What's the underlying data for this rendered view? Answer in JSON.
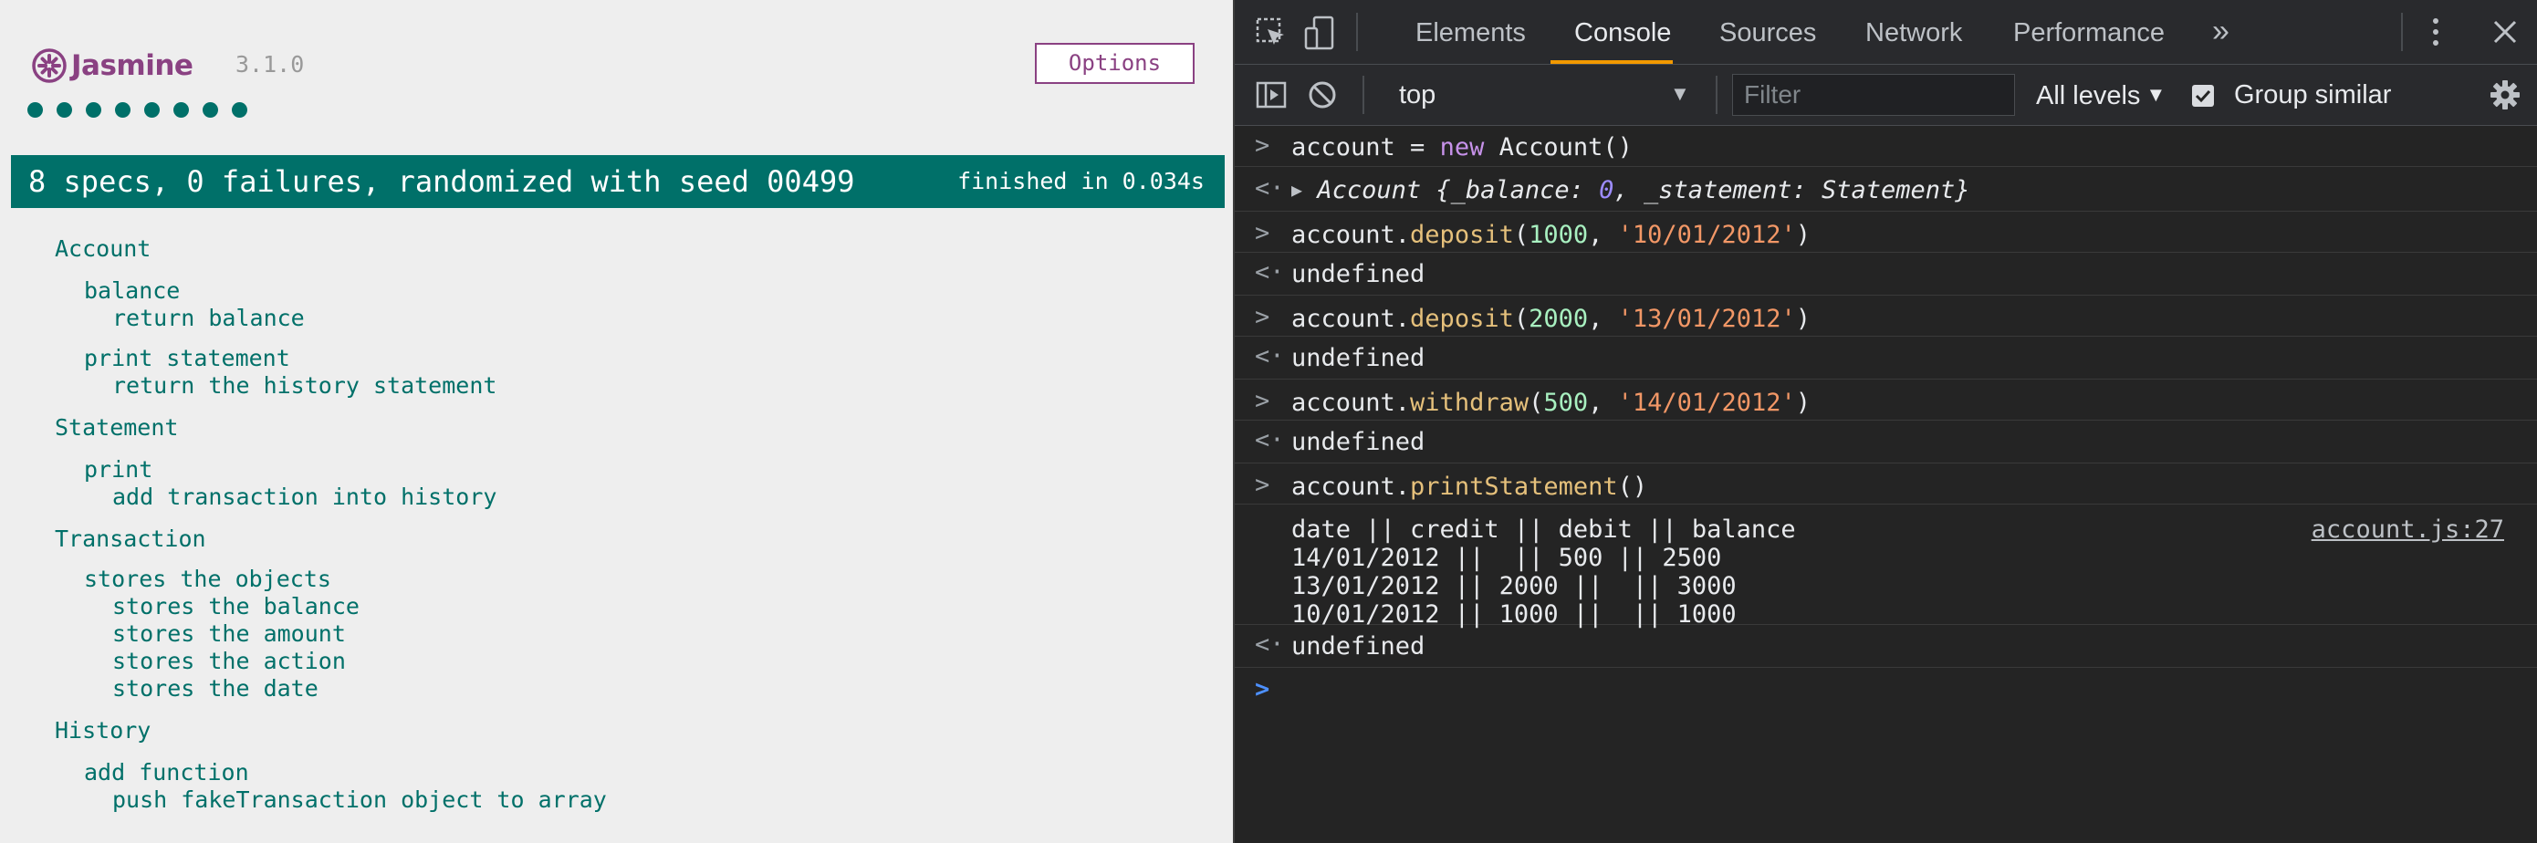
{
  "jasmine": {
    "logo": "Jasmine",
    "version": "3.1.0",
    "options_label": "Options",
    "dot_count": 8,
    "summary": "8 specs, 0 failures, randomized with seed 00499",
    "duration": "finished in 0.034s",
    "colors": {
      "brand": "#8a4182",
      "passed": "#007069"
    },
    "tree": [
      {
        "suite": "Account",
        "groups": [
          {
            "name": "balance",
            "specs": [
              "return balance"
            ]
          },
          {
            "name": "print statement",
            "specs": [
              "return the history statement"
            ]
          }
        ]
      },
      {
        "suite": "Statement",
        "groups": [
          {
            "name": "print",
            "specs": [
              "add transaction into history"
            ]
          }
        ]
      },
      {
        "suite": "Transaction",
        "groups": [
          {
            "name": "stores the objects",
            "specs": [
              "stores the balance",
              "stores the amount",
              "stores the action",
              "stores the date"
            ]
          }
        ]
      },
      {
        "suite": "History",
        "groups": [
          {
            "name": "add function",
            "specs": [
              "push fakeTransaction object to array"
            ]
          }
        ]
      }
    ]
  },
  "devtools": {
    "tabs": [
      "Elements",
      "Console",
      "Sources",
      "Network",
      "Performance"
    ],
    "active_tab": "Console",
    "more_tabs": "»",
    "context": "top",
    "filter_placeholder": "Filter",
    "levels": "All levels",
    "group_similar": "Group similar",
    "console": {
      "cmd1": {
        "obj": "account",
        "op": " = ",
        "kw": "new",
        "rest": " Account()"
      },
      "out1": {
        "head": "Account {_balance: ",
        "zero": "0",
        "tail": ", _statement: Statement}"
      },
      "cmd2": {
        "obj": "account.",
        "fn": "deposit",
        "open": "(",
        "num": "1000",
        "comma": ", ",
        "str": "'10/01/2012'",
        "close": ")"
      },
      "cmd3": {
        "obj": "account.",
        "fn": "deposit",
        "open": "(",
        "num": "2000",
        "comma": ", ",
        "str": "'13/01/2012'",
        "close": ")"
      },
      "cmd4": {
        "obj": "account.",
        "fn": "withdraw",
        "open": "(",
        "num": "500",
        "comma": ", ",
        "str": "'14/01/2012'",
        "close": ")"
      },
      "cmd5": {
        "obj": "account.",
        "fn": "printStatement",
        "call": "()"
      },
      "undef": "undefined",
      "statement_lines": [
        "date || credit || debit || balance",
        "14/01/2012 ||  || 500 || 2500",
        "13/01/2012 || 2000 ||  || 3000",
        "10/01/2012 || 1000 ||  || 1000"
      ],
      "source_link": "account.js:27"
    }
  }
}
